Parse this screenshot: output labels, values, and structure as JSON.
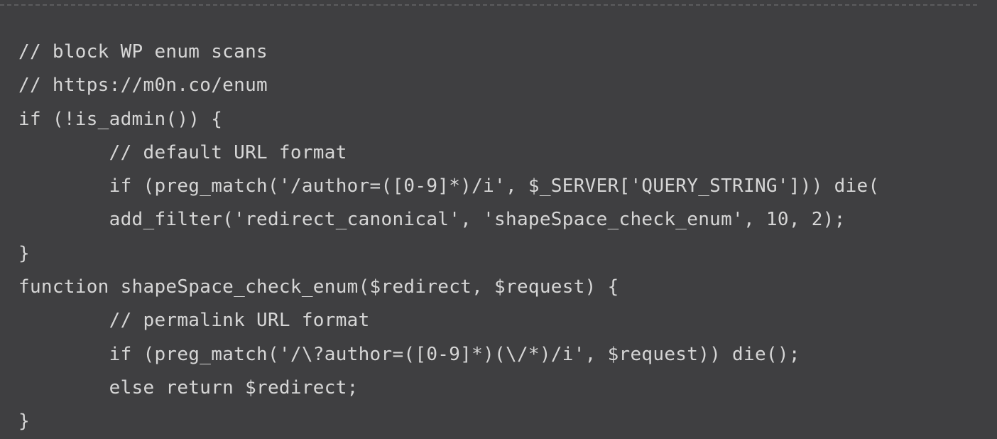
{
  "code": {
    "lines": [
      "// block WP enum scans",
      "// https://m0n.co/enum",
      "if (!is_admin()) {",
      "\t// default URL format",
      "\tif (preg_match('/author=([0-9]*)/i', $_SERVER['QUERY_STRING'])) die(",
      "\tadd_filter('redirect_canonical', 'shapeSpace_check_enum', 10, 2);",
      "}",
      "function shapeSpace_check_enum($redirect, $request) {",
      "\t// permalink URL format",
      "\tif (preg_match('/\\?author=([0-9]*)(\\/*)/i', $request)) die();",
      "\telse return $redirect;",
      "}"
    ]
  }
}
